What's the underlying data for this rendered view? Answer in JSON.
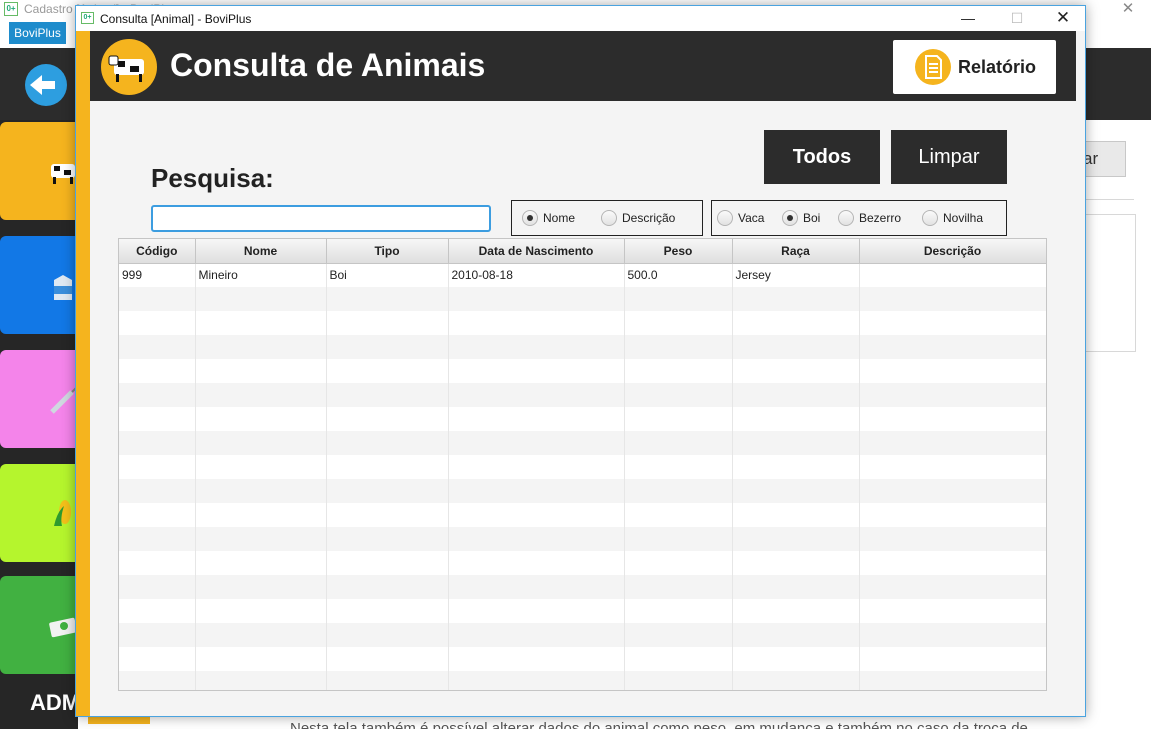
{
  "background": {
    "title": "Cadastro [Animal] - BoviPlus",
    "menu_button": "BoviPlus",
    "side_label": "ADM",
    "partial_button": "ar",
    "bottom_text": "Nesta tela também é possível alterar dados do animal como peso, em mudança e também no caso da troca de"
  },
  "dialog": {
    "title": "Consulta [Animal] - BoviPlus",
    "header_title": "Consulta de Animais",
    "report_label": "Relatório",
    "btn_all": "Todos",
    "btn_clear": "Limpar",
    "search_label": "Pesquisa:",
    "search_value": "",
    "filter_field": {
      "options": [
        "Nome",
        "Descrição"
      ],
      "selected": "Nome"
    },
    "filter_type": {
      "options": [
        "Vaca",
        "Boi",
        "Bezerro",
        "Novilha"
      ],
      "selected": "Boi"
    }
  },
  "table": {
    "columns": [
      "Código",
      "Nome",
      "Tipo",
      "Data de Nascimento",
      "Peso",
      "Raça",
      "Descrição"
    ],
    "rows": [
      [
        "999",
        "Mineiro",
        "Boi",
        "2010-08-18",
        "500.0",
        "Jersey",
        ""
      ]
    ],
    "empty_rows": 17
  },
  "icons": {
    "back": "arrow-left-icon",
    "logo": "cow-icon",
    "report": "document-icon",
    "tiles": [
      "cow-icon",
      "milk-carton-icon",
      "syringe-icon",
      "corn-icon",
      "money-icon"
    ]
  },
  "colors": {
    "accent_yellow": "#f5b41e",
    "header_dark": "#2c2c2c",
    "focus_blue": "#3c9de0",
    "tile_blue": "#1278e6",
    "tile_pink": "#f484ea",
    "tile_lime": "#b5f52d",
    "tile_green": "#41b141"
  }
}
